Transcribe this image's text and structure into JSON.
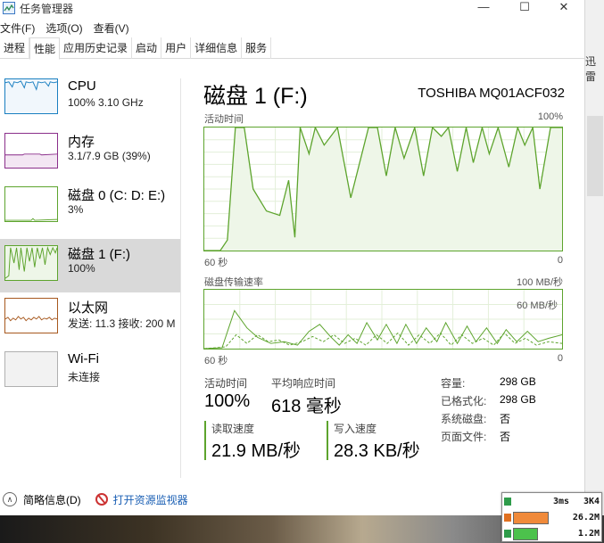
{
  "window": {
    "title": "任务管理器",
    "controls": {
      "minimize": "—",
      "maximize": "☐",
      "close": "✕"
    }
  },
  "menu": [
    "文件(F)",
    "选项(O)",
    "查看(V)"
  ],
  "tabs": [
    "进程",
    "性能",
    "应用历史记录",
    "启动",
    "用户",
    "详细信息",
    "服务"
  ],
  "sidebar": [
    {
      "name": "CPU",
      "value": "100% 3.10 GHz"
    },
    {
      "name": "内存",
      "value": "3.1/7.9 GB (39%)"
    },
    {
      "name": "磁盘 0 (C: D: E:)",
      "value": "3%"
    },
    {
      "name": "磁盘 1 (F:)",
      "value": "100%"
    },
    {
      "name": "以太网",
      "value": "发送: 11.3  接收: 200 M"
    },
    {
      "name": "Wi-Fi",
      "value": "未连接"
    }
  ],
  "main": {
    "title": "磁盘 1 (F:)",
    "model": "TOSHIBA MQ01ACF032",
    "graph1": {
      "label": "活动时间",
      "max": "100%",
      "x_left": "60 秒",
      "x_right": "0"
    },
    "graph2": {
      "label": "磁盘传输速率",
      "max": "100 MB/秒",
      "sub_max": "60 MB/秒",
      "x_left": "60 秒",
      "x_right": "0"
    },
    "stats": {
      "active_label": "活动时间",
      "active_value": "100%",
      "resp_label": "平均响应时间",
      "resp_value": "618 毫秒",
      "read_label": "读取速度",
      "read_value": "21.9 MB/秒",
      "write_label": "写入速度",
      "write_value": "28.3 KB/秒"
    },
    "info": [
      {
        "k": "容量:",
        "v": "298 GB"
      },
      {
        "k": "已格式化:",
        "v": "298 GB"
      },
      {
        "k": "系统磁盘:",
        "v": "否"
      },
      {
        "k": "页面文件:",
        "v": "否"
      }
    ]
  },
  "footer": {
    "summary": "简略信息(D)",
    "monitor_link": "打开资源监视器"
  },
  "desktop": {
    "side_text": "迅雷"
  },
  "overlay": {
    "latency": "3ms",
    "cpu_tag": "3K4",
    "down": "26.2M",
    "up": "1.2M"
  },
  "colors": {
    "disk_green": "#5da42d",
    "cpu_blue": "#1a7fc1",
    "mem_purple": "#8b2f8b",
    "eth_brown": "#a7581e",
    "wifi_gray": "#b0b0b0"
  }
}
